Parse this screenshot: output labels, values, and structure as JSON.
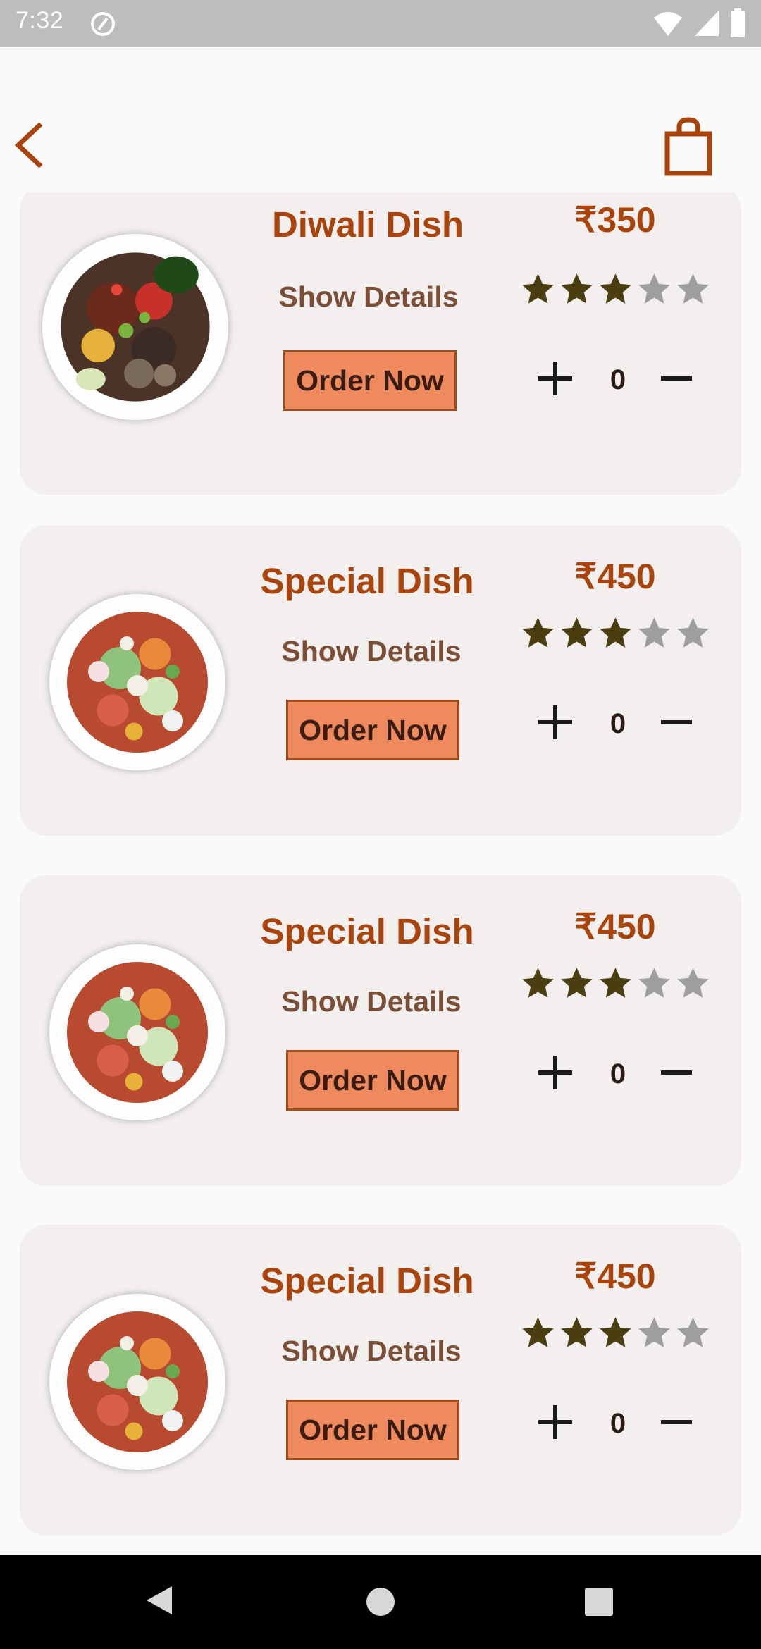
{
  "status_bar": {
    "time": "7:32"
  },
  "colors": {
    "accent": "#a9440d",
    "button_fill": "#ee8a5d",
    "button_border": "#9e4b1e",
    "card_bg": "#f3efef",
    "star_filled": "#4a3e10",
    "star_empty": "#9e9e9e"
  },
  "app_bar": {
    "back_icon": "chevron-left-icon",
    "cart_icon": "shopping-bag-icon"
  },
  "dishes": [
    {
      "title": "Diwali Dish",
      "price": "₹350",
      "details_label": "Show Details",
      "order_label": "Order Now",
      "rating": 3,
      "max_rating": 5,
      "quantity": "0",
      "plus": "+",
      "minus": "−"
    },
    {
      "title": "Special Dish",
      "price": "₹450",
      "details_label": "Show Details",
      "order_label": "Order Now",
      "rating": 3,
      "max_rating": 5,
      "quantity": "0",
      "plus": "+",
      "minus": "−"
    },
    {
      "title": "Special Dish",
      "price": "₹450",
      "details_label": "Show Details",
      "order_label": "Order Now",
      "rating": 3,
      "max_rating": 5,
      "quantity": "0",
      "plus": "+",
      "minus": "−"
    },
    {
      "title": "Special Dish",
      "price": "₹450",
      "details_label": "Show Details",
      "order_label": "Order Now",
      "rating": 3,
      "max_rating": 5,
      "quantity": "0",
      "plus": "+",
      "minus": "−"
    }
  ],
  "nav_bar": {
    "back_icon": "triangle-back-icon",
    "home_icon": "circle-home-icon",
    "recent_icon": "square-recents-icon"
  }
}
